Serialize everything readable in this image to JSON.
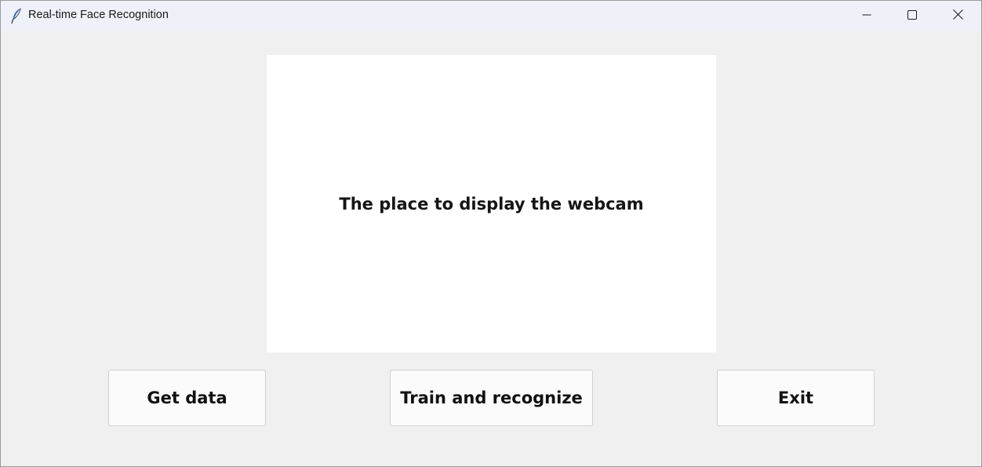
{
  "window": {
    "title": "Real-time Face Recognition",
    "icon": "feather-icon",
    "controls": {
      "minimize": "minimize-icon",
      "maximize": "maximize-icon",
      "close": "close-icon"
    }
  },
  "main": {
    "webcam_placeholder": "The place to display the webcam",
    "buttons": {
      "get_data": "Get data",
      "train_recognize": "Train and recognize",
      "exit": "Exit"
    }
  },
  "colors": {
    "titlebar": "#eef2f8",
    "background": "#f0f0f0",
    "panel": "#ffffff",
    "button": "#fbfbfb"
  }
}
